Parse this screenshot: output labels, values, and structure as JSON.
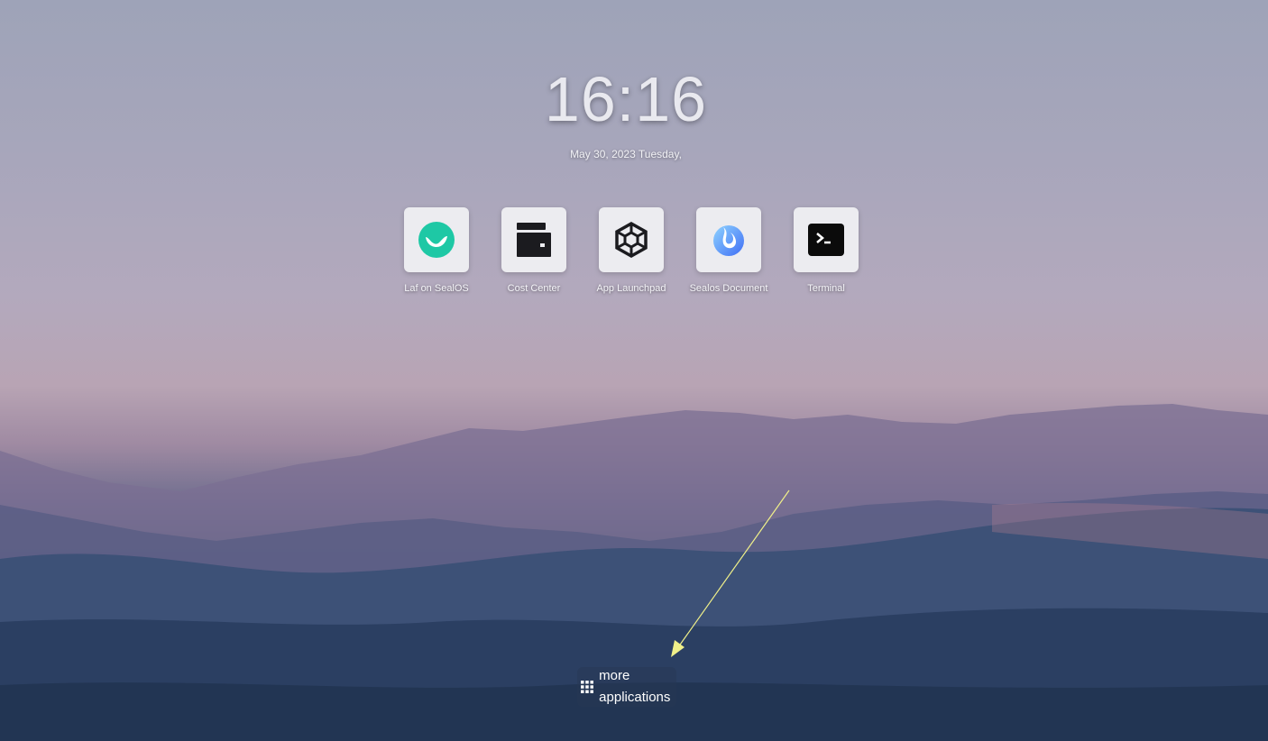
{
  "desktop": {
    "clock": "16:16",
    "date": "May 30, 2023 Tuesday,"
  },
  "apps": [
    {
      "label": "Laf on SealOS",
      "icon": "laf-icon"
    },
    {
      "label": "Cost Center",
      "icon": "wallet-icon"
    },
    {
      "label": "App Launchpad",
      "icon": "launchpad-icon"
    },
    {
      "label": "Sealos Document",
      "icon": "document-icon"
    },
    {
      "label": "Terminal",
      "icon": "terminal-icon"
    }
  ],
  "more_apps": {
    "label": "more applications",
    "icon": "grid-icon"
  },
  "colors": {
    "laf_green": "#1ec8a5",
    "terminal_black": "#0b0b0b",
    "sealos_blue": "#3f8af5",
    "annotation_arrow": "#f0f08a"
  }
}
